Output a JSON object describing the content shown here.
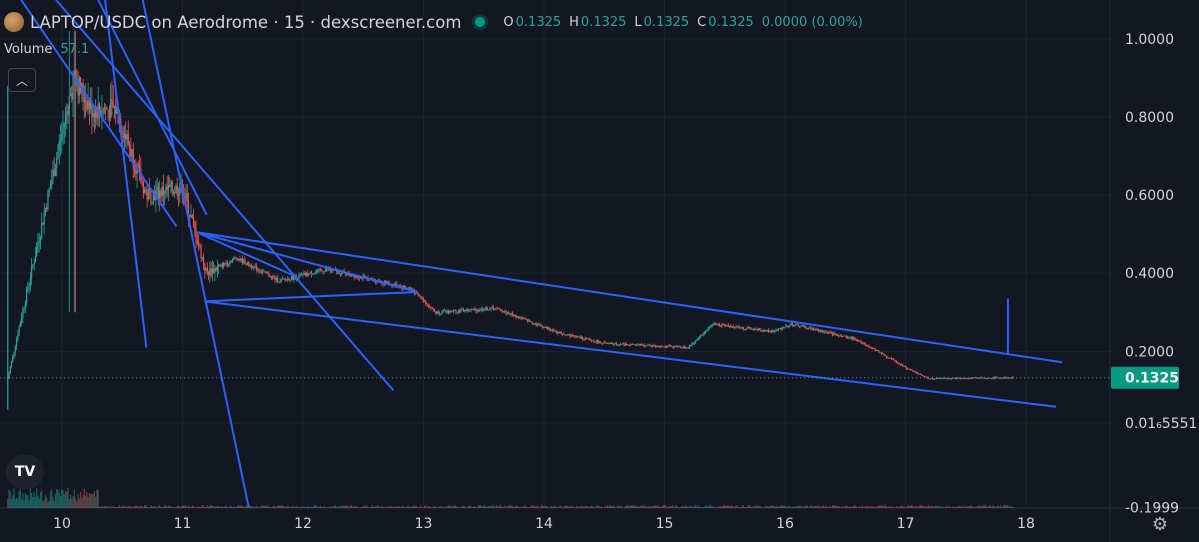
{
  "header": {
    "title": "LAPTOP/USDC on Aerodrome · 15 · dexscreener.com",
    "ohlc": [
      {
        "key": "O",
        "value": "0.1325"
      },
      {
        "key": "H",
        "value": "0.1325"
      },
      {
        "key": "L",
        "value": "0.1325"
      },
      {
        "key": "C",
        "value": "0.1325"
      }
    ],
    "change": "0.0000 (0.00%)"
  },
  "volume": {
    "label": "Volume",
    "value": "57.1"
  },
  "price_tag": "0.1325",
  "colors": {
    "up": "#26a69a",
    "down": "#ef5350",
    "drawing": "#2962ff",
    "background": "#131722",
    "text": "#d1d4dc"
  },
  "icons": {
    "collapse": "chevron-up-icon",
    "logo": "tradingview-logo-icon",
    "settings": "gear-icon"
  },
  "chart_data": {
    "type": "candlestick",
    "title": "LAPTOP/USDC on Aerodrome · 15 · dexscreener.com",
    "x_ticks": [
      "10",
      "11",
      "12",
      "13",
      "14",
      "15",
      "16",
      "17",
      "18"
    ],
    "y_ticks": [
      "1.0000",
      "0.8000",
      "0.6000",
      "0.4000",
      "0.2000",
      "0.01₆5551",
      "-0.1999"
    ],
    "ylim": [
      -0.2,
      1.05
    ],
    "last_price": 0.1325,
    "grid": true,
    "price_path": [
      {
        "day": 9.55,
        "price": 0.13
      },
      {
        "day": 10.1,
        "price": 0.9
      },
      {
        "day": 10.25,
        "price": 0.82
      },
      {
        "day": 10.45,
        "price": 0.82
      },
      {
        "day": 10.7,
        "price": 0.6
      },
      {
        "day": 11.0,
        "price": 0.62
      },
      {
        "day": 11.2,
        "price": 0.4
      },
      {
        "day": 11.45,
        "price": 0.44
      },
      {
        "day": 11.8,
        "price": 0.38
      },
      {
        "day": 12.2,
        "price": 0.41
      },
      {
        "day": 12.9,
        "price": 0.36
      },
      {
        "day": 13.1,
        "price": 0.3
      },
      {
        "day": 13.6,
        "price": 0.31
      },
      {
        "day": 14.1,
        "price": 0.25
      },
      {
        "day": 14.5,
        "price": 0.22
      },
      {
        "day": 15.2,
        "price": 0.21
      },
      {
        "day": 15.4,
        "price": 0.27
      },
      {
        "day": 15.9,
        "price": 0.25
      },
      {
        "day": 16.05,
        "price": 0.27
      },
      {
        "day": 16.6,
        "price": 0.23
      },
      {
        "day": 17.05,
        "price": 0.15
      },
      {
        "day": 17.2,
        "price": 0.13
      },
      {
        "day": 17.9,
        "price": 0.1325
      }
    ],
    "trendlines": [
      {
        "from": {
          "day": 11.12,
          "price": 0.505
        },
        "to": {
          "day": 18.3,
          "price": 0.172
        }
      },
      {
        "from": {
          "day": 11.18,
          "price": 0.328
        },
        "to": {
          "day": 18.25,
          "price": 0.058
        }
      },
      {
        "from": {
          "day": 11.18,
          "price": 0.328
        },
        "to": {
          "day": 12.95,
          "price": 0.352
        }
      },
      {
        "from": {
          "day": 11.12,
          "price": 0.505
        },
        "to": {
          "day": 12.95,
          "price": 0.352
        }
      },
      {
        "from": {
          "day": 9.95,
          "price": 1.1
        },
        "to": {
          "day": 12.75,
          "price": 0.1
        }
      },
      {
        "from": {
          "day": 10.3,
          "price": 1.1
        },
        "to": {
          "day": 11.2,
          "price": 0.55
        }
      },
      {
        "from": {
          "day": 9.55,
          "price": 1.15
        },
        "to": {
          "day": 10.95,
          "price": 0.52
        }
      },
      {
        "from": {
          "day": 10.35,
          "price": 1.12
        },
        "to": {
          "day": 10.7,
          "price": 0.21
        }
      },
      {
        "from": {
          "day": 10.65,
          "price": 1.13
        },
        "to": {
          "day": 11.55,
          "price": -0.2
        }
      },
      {
        "from": {
          "day": 11.12,
          "price": 0.505
        },
        "to": {
          "day": 11.95,
          "price": 0.39
        }
      },
      {
        "from": {
          "day": 17.85,
          "price": 0.335
        },
        "to": {
          "day": 17.85,
          "price": 0.195
        }
      }
    ]
  }
}
